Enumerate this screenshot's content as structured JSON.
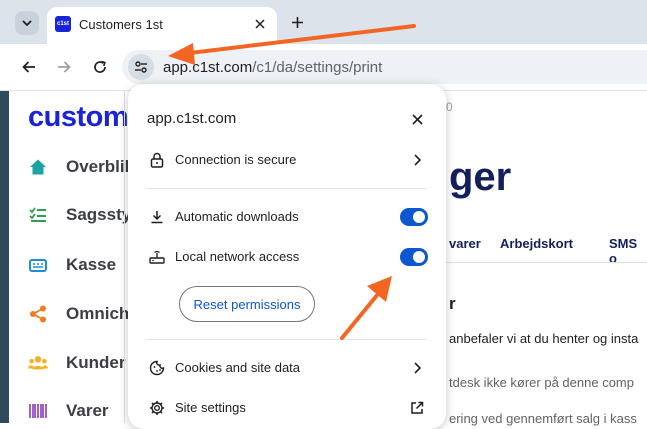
{
  "browser": {
    "tab": {
      "favicon_text": "c1st",
      "title": "Customers 1st"
    },
    "omnibox": {
      "host": "app.c1st.com",
      "path": "/c1/da/settings/print"
    }
  },
  "page": {
    "logo": "custom",
    "sidebar": [
      {
        "label": "Overblik",
        "icon": "home-icon",
        "color": "#1aa3a3"
      },
      {
        "label": "Sagsstyr",
        "icon": "checklist-icon",
        "color": "#2e9e4f"
      },
      {
        "label": "Kasse",
        "icon": "register-icon",
        "color": "#1a8fd6"
      },
      {
        "label": "Omnich",
        "icon": "share-icon",
        "color": "#f07c22"
      },
      {
        "label": "Kunder",
        "icon": "people-icon",
        "color": "#f5b21b"
      },
      {
        "label": "Varer",
        "icon": "barcode-icon",
        "color": "#8a3ab9"
      }
    ],
    "crumb_number": "0",
    "heading": "ger",
    "tabs": [
      "varer",
      "Arbejdskort",
      "SMS o"
    ],
    "section_title": "r",
    "text_lines": [
      "anbefaler vi at du henter og insta",
      "tdesk ikke kører på denne comp",
      "ering ved gennemført salg i kass"
    ]
  },
  "popup": {
    "host": "app.c1st.com",
    "connection": "Connection is secure",
    "automatic_downloads": {
      "label": "Automatic downloads",
      "enabled": true
    },
    "local_network": {
      "label": "Local network access",
      "enabled": true
    },
    "reset_label": "Reset permissions",
    "cookies_label": "Cookies and site data",
    "site_settings_label": "Site settings"
  },
  "colors": {
    "accent": "#0b57d0",
    "annotation_arrow": "#f26522",
    "brand": "#1a24d6"
  }
}
